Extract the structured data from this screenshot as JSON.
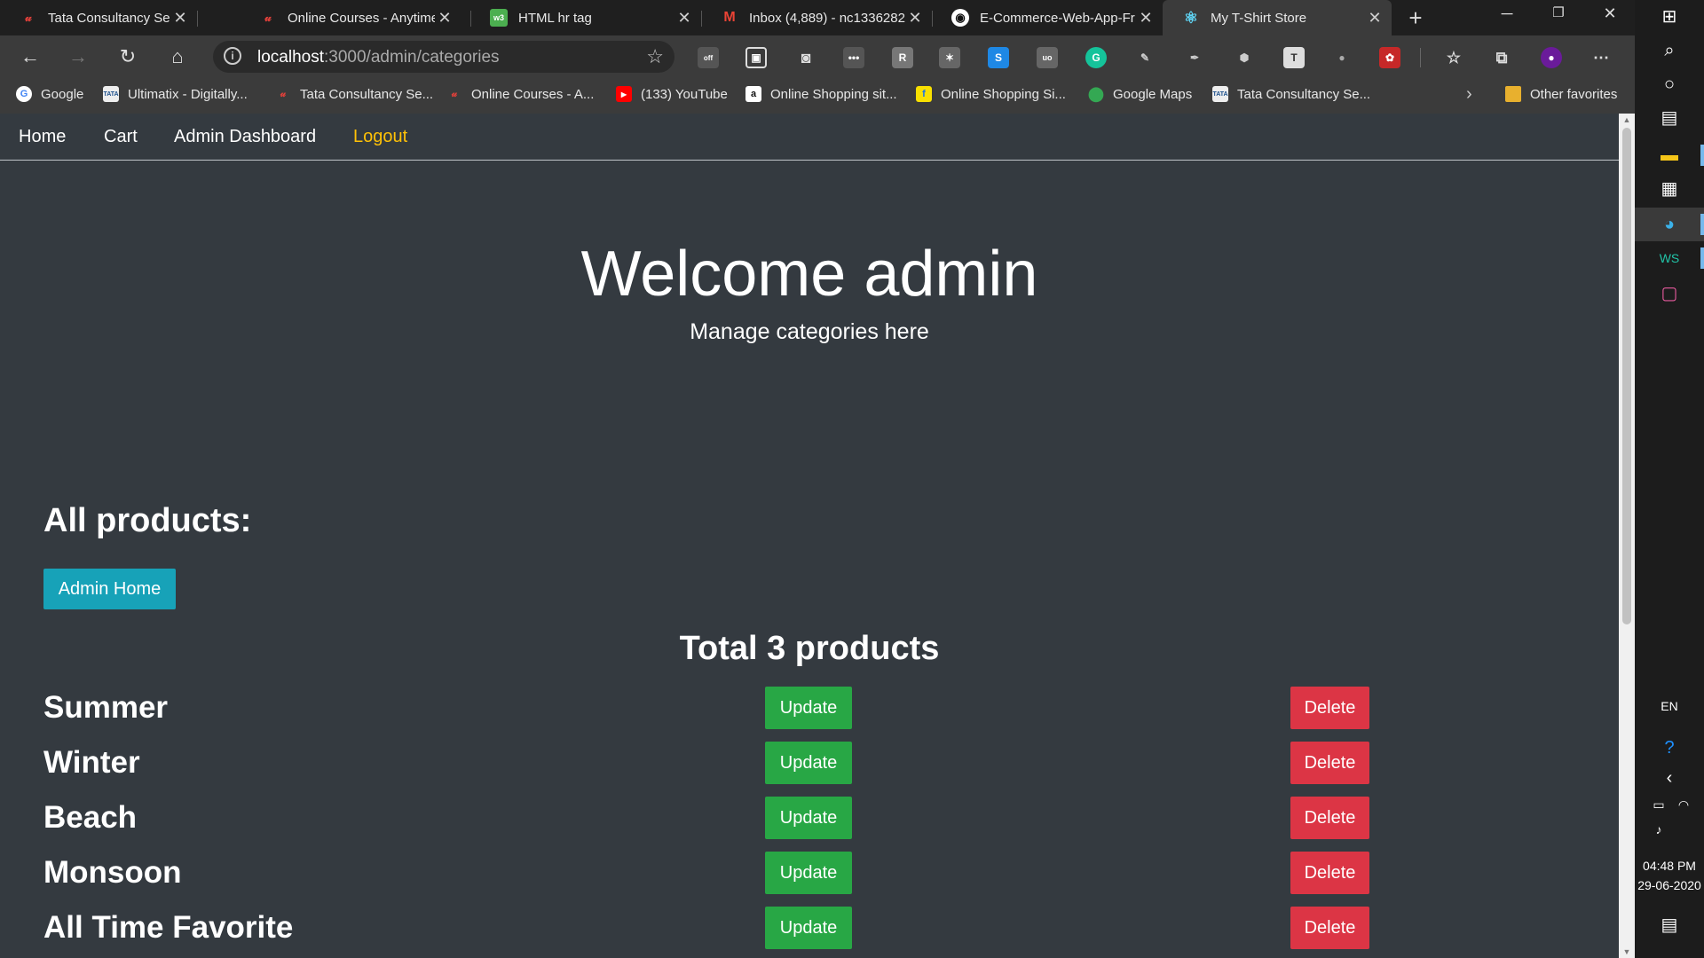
{
  "browser": {
    "tabs": [
      {
        "title": "Tata Consultancy Services E",
        "icon": "tcs-logo-icon"
      },
      {
        "title": "Online Courses - Anytime,",
        "icon": "udemy-logo-icon"
      },
      {
        "title": "HTML hr tag",
        "icon": "w3schools-icon"
      },
      {
        "title": "Inbox (4,889) - nc1336282",
        "icon": "gmail-icon"
      },
      {
        "title": "E-Commerce-Web-App-Fr",
        "icon": "github-icon"
      },
      {
        "title": "My T-Shirt Store",
        "icon": "react-icon"
      }
    ],
    "address": {
      "host": "localhost",
      "path": ":3000/admin/categories"
    },
    "bookmarks": [
      {
        "label": "Google",
        "icon": "google-icon"
      },
      {
        "label": "Ultimatix - Digitally...",
        "icon": "tata-icon"
      },
      {
        "label": "Tata Consultancy Se...",
        "icon": "udemy-icon"
      },
      {
        "label": "Online Courses - A...",
        "icon": "udemy-icon"
      },
      {
        "label": "(133) YouTube",
        "icon": "youtube-icon"
      },
      {
        "label": "Online Shopping sit...",
        "icon": "amazon-icon"
      },
      {
        "label": "Online Shopping Si...",
        "icon": "flipkart-icon"
      },
      {
        "label": "Google Maps",
        "icon": "maps-pin-icon"
      },
      {
        "label": "Tata Consultancy Se...",
        "icon": "tata-icon"
      }
    ],
    "other_favorites": "Other favorites",
    "extension_badge": "off"
  },
  "site": {
    "nav": {
      "home": "Home",
      "cart": "Cart",
      "admin_dashboard": "Admin Dashboard",
      "logout": "Logout"
    },
    "hero": {
      "title": "Welcome admin",
      "subtitle": "Manage categories here"
    },
    "section_heading": "All products:",
    "admin_home_button": "Admin Home",
    "total_title": "Total 3 products",
    "categories": [
      {
        "name": "Summer",
        "update": "Update",
        "delete": "Delete"
      },
      {
        "name": "Winter",
        "update": "Update",
        "delete": "Delete"
      },
      {
        "name": "Beach",
        "update": "Update",
        "delete": "Delete"
      },
      {
        "name": "Monsoon",
        "update": "Update",
        "delete": "Delete"
      },
      {
        "name": "All Time Favorite",
        "update": "Update",
        "delete": "Delete"
      }
    ]
  },
  "taskbar": {
    "language": "EN",
    "time": "04:48 PM",
    "date": "29-06-2020"
  },
  "colors": {
    "page_bg": "#343a40",
    "info": "#17a2b8",
    "success": "#28a745",
    "danger": "#dc3545",
    "warning": "#ffc107"
  }
}
